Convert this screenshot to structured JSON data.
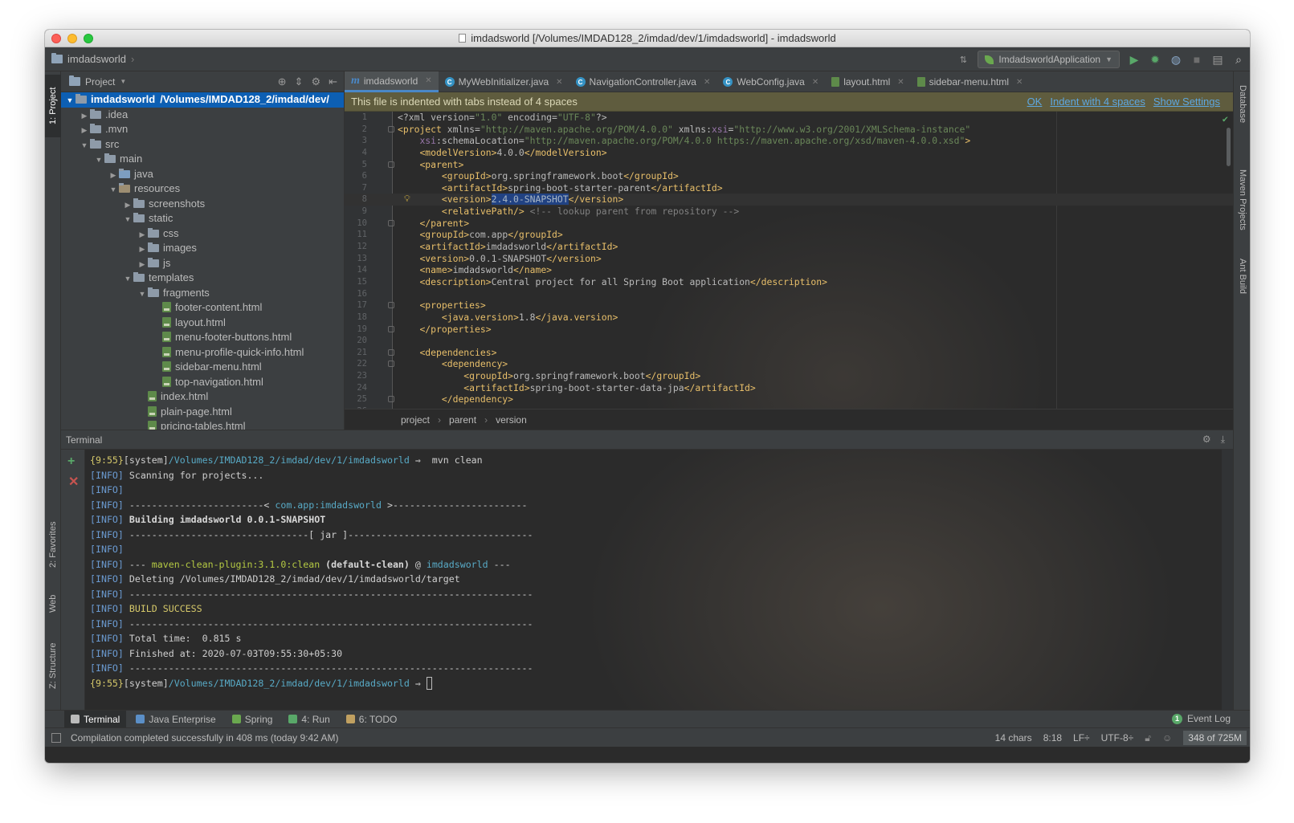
{
  "window": {
    "title": "imdadsworld [/Volumes/IMDAD128_2/imdad/dev/1/imdadsworld] - imdadsworld"
  },
  "navbar": {
    "crumb": "imdadsworld",
    "run_config": "ImdadsworldApplication"
  },
  "left_strip": {
    "project": "1: Project",
    "favorites": "2: Favorites",
    "web": "Web",
    "structure": "Z: Structure"
  },
  "right_strip": {
    "database": "Database",
    "maven": "Maven Projects",
    "ant": "Ant Build"
  },
  "project_panel": {
    "title": "Project",
    "tree": [
      {
        "label": "imdadsworld",
        "path": "/Volumes/IMDAD128_2/imdad/dev/",
        "depth": 0,
        "arrow": "▼",
        "kind": "module",
        "selected": true
      },
      {
        "label": ".idea",
        "depth": 1,
        "arrow": "▶",
        "kind": "folder"
      },
      {
        "label": ".mvn",
        "depth": 1,
        "arrow": "▶",
        "kind": "folder"
      },
      {
        "label": "src",
        "depth": 1,
        "arrow": "▼",
        "kind": "folder"
      },
      {
        "label": "main",
        "depth": 2,
        "arrow": "▼",
        "kind": "folder"
      },
      {
        "label": "java",
        "depth": 3,
        "arrow": "▶",
        "kind": "src"
      },
      {
        "label": "resources",
        "depth": 3,
        "arrow": "▼",
        "kind": "res"
      },
      {
        "label": "screenshots",
        "depth": 4,
        "arrow": "▶",
        "kind": "folder"
      },
      {
        "label": "static",
        "depth": 4,
        "arrow": "▼",
        "kind": "folder"
      },
      {
        "label": "css",
        "depth": 5,
        "arrow": "▶",
        "kind": "folder"
      },
      {
        "label": "images",
        "depth": 5,
        "arrow": "▶",
        "kind": "folder"
      },
      {
        "label": "js",
        "depth": 5,
        "arrow": "▶",
        "kind": "folder"
      },
      {
        "label": "templates",
        "depth": 4,
        "arrow": "▼",
        "kind": "folder"
      },
      {
        "label": "fragments",
        "depth": 5,
        "arrow": "▼",
        "kind": "folder"
      },
      {
        "label": "footer-content.html",
        "depth": 6,
        "arrow": "",
        "kind": "html"
      },
      {
        "label": "layout.html",
        "depth": 6,
        "arrow": "",
        "kind": "html"
      },
      {
        "label": "menu-footer-buttons.html",
        "depth": 6,
        "arrow": "",
        "kind": "html"
      },
      {
        "label": "menu-profile-quick-info.html",
        "depth": 6,
        "arrow": "",
        "kind": "html"
      },
      {
        "label": "sidebar-menu.html",
        "depth": 6,
        "arrow": "",
        "kind": "html"
      },
      {
        "label": "top-navigation.html",
        "depth": 6,
        "arrow": "",
        "kind": "html"
      },
      {
        "label": "index.html",
        "depth": 5,
        "arrow": "",
        "kind": "html"
      },
      {
        "label": "plain-page.html",
        "depth": 5,
        "arrow": "",
        "kind": "html"
      },
      {
        "label": "pricing-tables.html",
        "depth": 5,
        "arrow": "",
        "kind": "html"
      }
    ]
  },
  "editor": {
    "tabs": [
      {
        "label": "imdadsworld",
        "icon": "maven-icon",
        "active": true
      },
      {
        "label": "MyWebInitializer.java",
        "icon": "class-icon"
      },
      {
        "label": "NavigationController.java",
        "icon": "class-icon"
      },
      {
        "label": "WebConfig.java",
        "icon": "class-icon"
      },
      {
        "label": "layout.html",
        "icon": "html-icon"
      },
      {
        "label": "sidebar-menu.html",
        "icon": "html-icon"
      }
    ],
    "notification": {
      "message": "This file is indented with tabs instead of 4 spaces",
      "actions": [
        "OK",
        "Indent with 4 spaces",
        "Show Settings"
      ]
    },
    "breadcrumbs": [
      "project",
      "parent",
      "version"
    ]
  },
  "code_lines": [
    [
      [
        "<?xml version=",
        "at"
      ],
      [
        "\"1.0\"",
        "av"
      ],
      [
        " encoding=",
        "at"
      ],
      [
        "\"UTF-8\"",
        "av"
      ],
      [
        "?>",
        "at"
      ]
    ],
    [
      [
        "<project ",
        "tg"
      ],
      [
        "xmlns=",
        "at"
      ],
      [
        "\"http://maven.apache.org/POM/4.0.0\"",
        "av"
      ],
      [
        " xmlns:",
        "at"
      ],
      [
        "xsi",
        "ns"
      ],
      [
        "=",
        "at"
      ],
      [
        "\"http://www.w3.org/2001/XMLSchema-instance\"",
        "av"
      ]
    ],
    [
      [
        "    ",
        "at"
      ],
      [
        "xsi",
        "ns"
      ],
      [
        ":schemaLocation=",
        "at"
      ],
      [
        "\"http://maven.apache.org/POM/4.0.0 https://maven.apache.org/xsd/maven-4.0.0.xsd\"",
        "av"
      ],
      [
        ">",
        "tg"
      ]
    ],
    [
      [
        "    ",
        "at"
      ],
      [
        "<modelVersion>",
        "tg"
      ],
      [
        "4.0.0",
        "at"
      ],
      [
        "</modelVersion>",
        "tg"
      ]
    ],
    [
      [
        "    ",
        "at"
      ],
      [
        "<parent>",
        "tg"
      ]
    ],
    [
      [
        "        ",
        "at"
      ],
      [
        "<groupId>",
        "tg"
      ],
      [
        "org.springframework.boot",
        "at"
      ],
      [
        "</groupId>",
        "tg"
      ]
    ],
    [
      [
        "        ",
        "at"
      ],
      [
        "<artifactId>",
        "tg"
      ],
      [
        "spring-boot-starter-parent",
        "at"
      ],
      [
        "</artifactId>",
        "tg"
      ]
    ],
    [
      [
        "        ",
        "at"
      ],
      [
        "<version>",
        "tg"
      ],
      [
        "2.4.0-SNAPSHOT",
        "sel"
      ],
      [
        "</version>",
        "tg"
      ]
    ],
    [
      [
        "        ",
        "at"
      ],
      [
        "<relativePath/>",
        "tg"
      ],
      [
        " <!-- lookup parent from repository -->",
        "cm"
      ]
    ],
    [
      [
        "    ",
        "at"
      ],
      [
        "</parent>",
        "tg"
      ]
    ],
    [
      [
        "    ",
        "at"
      ],
      [
        "<groupId>",
        "tg"
      ],
      [
        "com.app",
        "at"
      ],
      [
        "</groupId>",
        "tg"
      ]
    ],
    [
      [
        "    ",
        "at"
      ],
      [
        "<artifactId>",
        "tg"
      ],
      [
        "imdadsworld",
        "at"
      ],
      [
        "</artifactId>",
        "tg"
      ]
    ],
    [
      [
        "    ",
        "at"
      ],
      [
        "<version>",
        "tg"
      ],
      [
        "0.0.1-SNAPSHOT",
        "at"
      ],
      [
        "</version>",
        "tg"
      ]
    ],
    [
      [
        "    ",
        "at"
      ],
      [
        "<name>",
        "tg"
      ],
      [
        "imdadsworld",
        "at"
      ],
      [
        "</name>",
        "tg"
      ]
    ],
    [
      [
        "    ",
        "at"
      ],
      [
        "<description>",
        "tg"
      ],
      [
        "Central project for all Spring Boot application",
        "at"
      ],
      [
        "</description>",
        "tg"
      ]
    ],
    [
      [
        "",
        "at"
      ]
    ],
    [
      [
        "    ",
        "at"
      ],
      [
        "<properties>",
        "tg"
      ]
    ],
    [
      [
        "        ",
        "at"
      ],
      [
        "<java.version>",
        "tg"
      ],
      [
        "1.8",
        "at"
      ],
      [
        "</java.version>",
        "tg"
      ]
    ],
    [
      [
        "    ",
        "at"
      ],
      [
        "</properties>",
        "tg"
      ]
    ],
    [
      [
        "",
        "at"
      ]
    ],
    [
      [
        "    ",
        "at"
      ],
      [
        "<dependencies>",
        "tg"
      ]
    ],
    [
      [
        "        ",
        "at"
      ],
      [
        "<dependency>",
        "tg"
      ]
    ],
    [
      [
        "            ",
        "at"
      ],
      [
        "<groupId>",
        "tg"
      ],
      [
        "org.springframework.boot",
        "at"
      ],
      [
        "</groupId>",
        "tg"
      ]
    ],
    [
      [
        "            ",
        "at"
      ],
      [
        "<artifactId>",
        "tg"
      ],
      [
        "spring-boot-starter-data-jpa",
        "at"
      ],
      [
        "</artifactId>",
        "tg"
      ]
    ],
    [
      [
        "        ",
        "at"
      ],
      [
        "</dependency>",
        "tg"
      ]
    ],
    [
      [
        "",
        "at"
      ]
    ]
  ],
  "terminal": {
    "title": "Terminal",
    "lines": [
      [
        [
          "{9:55}",
          "y"
        ],
        [
          "[system]",
          "w"
        ],
        [
          "/Volumes/IMDAD128_2/imdad/dev/1/imdadsworld",
          "c"
        ],
        [
          " ⇒  mvn clean",
          "w"
        ]
      ],
      [
        [
          "[INFO]",
          "info"
        ],
        [
          " Scanning for projects...",
          "w"
        ]
      ],
      [
        [
          "[INFO]",
          "info"
        ]
      ],
      [
        [
          "[INFO]",
          "info"
        ],
        [
          " ------------------------< ",
          "w"
        ],
        [
          "com.app:imdadsworld",
          "c"
        ],
        [
          " >------------------------",
          "w"
        ]
      ],
      [
        [
          "[INFO]",
          "info"
        ],
        [
          " Building imdadsworld 0.0.1-SNAPSHOT",
          "b"
        ]
      ],
      [
        [
          "[INFO]",
          "info"
        ],
        [
          " --------------------------------[ jar ]---------------------------------",
          "w"
        ]
      ],
      [
        [
          "[INFO]",
          "info"
        ]
      ],
      [
        [
          "[INFO]",
          "info"
        ],
        [
          " --- ",
          "w"
        ],
        [
          "maven-clean-plugin:3.1.0:clean",
          "g"
        ],
        [
          " (default-clean)",
          "b"
        ],
        [
          " @ ",
          "w"
        ],
        [
          "imdadsworld",
          "c"
        ],
        [
          " ---",
          "w"
        ]
      ],
      [
        [
          "[INFO]",
          "info"
        ],
        [
          " Deleting /Volumes/IMDAD128_2/imdad/dev/1/imdadsworld/target",
          "w"
        ]
      ],
      [
        [
          "[INFO]",
          "info"
        ],
        [
          " ------------------------------------------------------------------------",
          "w"
        ]
      ],
      [
        [
          "[INFO]",
          "info"
        ],
        [
          " BUILD SUCCESS",
          "y"
        ]
      ],
      [
        [
          "[INFO]",
          "info"
        ],
        [
          " ------------------------------------------------------------------------",
          "w"
        ]
      ],
      [
        [
          "[INFO]",
          "info"
        ],
        [
          " Total time:  0.815 s",
          "w"
        ]
      ],
      [
        [
          "[INFO]",
          "info"
        ],
        [
          " Finished at: 2020-07-03T09:55:30+05:30",
          "w"
        ]
      ],
      [
        [
          "[INFO]",
          "info"
        ],
        [
          " ------------------------------------------------------------------------",
          "w"
        ]
      ],
      [
        [
          "{9:55}",
          "y"
        ],
        [
          "[system]",
          "w"
        ],
        [
          "/Volumes/IMDAD128_2/imdad/dev/1/imdadsworld",
          "c"
        ],
        [
          " ⇒ ",
          "w"
        ]
      ]
    ]
  },
  "tool_tabs": [
    {
      "label": "Terminal",
      "active": true,
      "icon": "terminal-icon"
    },
    {
      "label": "Java Enterprise",
      "icon": "java-enterprise-icon"
    },
    {
      "label": "Spring",
      "icon": "spring-icon"
    },
    {
      "label": "4: Run",
      "icon": "run-icon"
    },
    {
      "label": "6: TODO",
      "icon": "todo-icon"
    }
  ],
  "event_log": {
    "label": "Event Log",
    "count": "1"
  },
  "status": {
    "message": "Compilation completed successfully in 408 ms (today 9:42 AM)",
    "chars": "14 chars",
    "position": "8:18",
    "line_sep": "LF÷",
    "encoding": "UTF-8÷",
    "memory": "348 of 725M"
  },
  "colors": {
    "accent": "#4a88c7",
    "selection": "#0d5fb3",
    "notif_bg": "#5f5c3e",
    "editor_bg": "#2b2b2b",
    "panel_bg": "#3c3f41"
  }
}
